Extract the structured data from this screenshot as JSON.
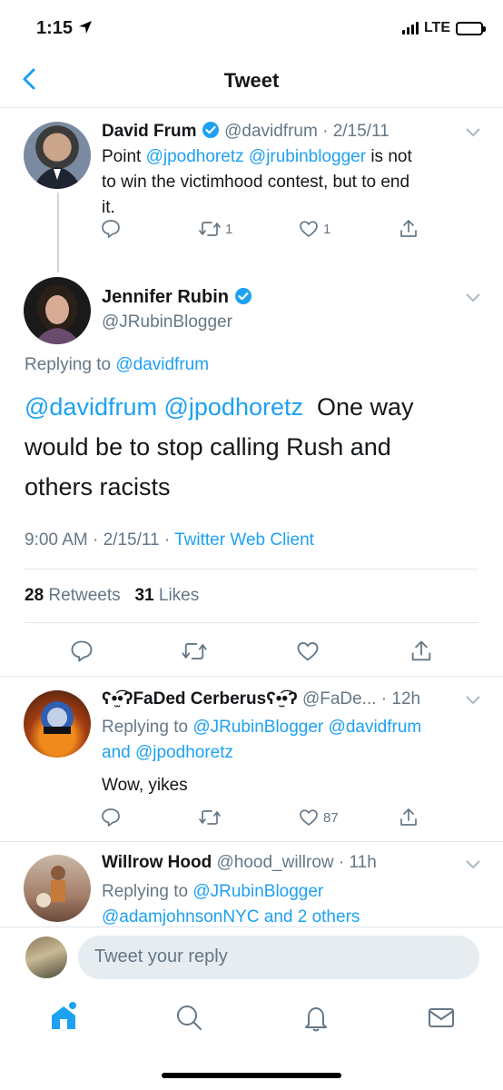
{
  "status_bar": {
    "time": "1:15",
    "network": "LTE"
  },
  "nav": {
    "title": "Tweet"
  },
  "tweets": [
    {
      "name": "David Frum",
      "handle": "@davidfrum",
      "date": "2/15/11",
      "text_parts": [
        "Point ",
        "@jpodhoretz",
        " ",
        "@jrubinblogger",
        " is not"
      ],
      "text_line2": "to win the victimhood contest, but to end",
      "text_line3": "it.",
      "retweets": "1",
      "likes": "1"
    }
  ],
  "main_tweet": {
    "name": "Jennifer Rubin",
    "handle": "@JRubinBlogger",
    "replying_prefix": "Replying to",
    "replying_to": "@davidfrum",
    "mention1": "@davidfrum",
    "mention2": "@jpodhoretz",
    "text_line1_rest": "One way",
    "text_line2": "would be to stop calling Rush and",
    "text_line3": "others racists",
    "timestamp": "9:00 AM · 2/15/11 · ",
    "client": "Twitter Web Client",
    "retweet_count": "28",
    "retweet_label": "Retweets",
    "like_count": "31",
    "like_label": "Likes"
  },
  "replies": [
    {
      "name": "ʕ•̫͡•ʔFaDed Cerberusʕ•̫͡•ʔ",
      "handle": "@FaDe...",
      "time": "12h",
      "replying_prefix": "Replying to",
      "replying_line1_mentions": "@JRubinBlogger @davidfrum",
      "replying_line2_and": "and",
      "replying_line2_mention": "@jpodhoretz",
      "text": "Wow, yikes",
      "likes": "87"
    },
    {
      "name": "Willrow Hood",
      "handle": "@hood_willrow",
      "time": "11h",
      "replying_prefix": "Replying to",
      "replying_line1_mentions": "@JRubinBlogger",
      "replying_line2": "@adamjohnsonNYC and 2 others"
    }
  ],
  "reply_bar": {
    "placeholder": "Tweet your reply"
  },
  "colors": {
    "accent": "#1da1f2",
    "secondary_text": "#657786",
    "divider": "#e1e8ed"
  }
}
